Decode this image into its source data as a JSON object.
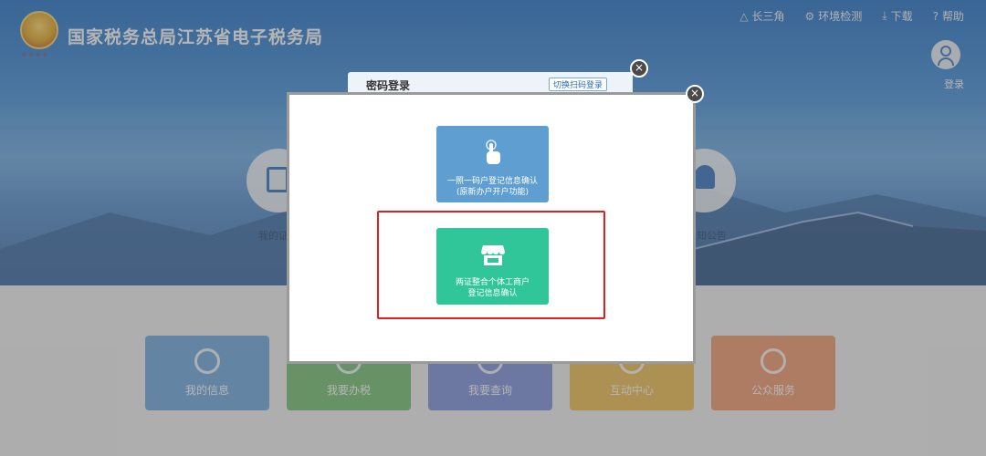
{
  "header": {
    "site_title": "国家税务总局江苏省电子税务局",
    "nav": [
      {
        "label": "长三角",
        "icon": "triangle-network-icon"
      },
      {
        "label": "环境检测",
        "icon": "wrench-icon"
      },
      {
        "label": "下载",
        "icon": "download-icon"
      },
      {
        "label": "帮助",
        "icon": "help-icon"
      }
    ],
    "login_label": "登录"
  },
  "background": {
    "left_circle_label": "我的证",
    "right_circle_label": "知公告",
    "tiles": [
      {
        "label": "我的信息",
        "color": "#6aa8df"
      },
      {
        "label": "我要办税",
        "color": "#72c06d"
      },
      {
        "label": "我要查询",
        "color": "#7b8fdc"
      },
      {
        "label": "互动中心",
        "color": "#f0bd4c"
      },
      {
        "label": "公众服务",
        "color": "#f2956a"
      }
    ]
  },
  "behind_dialog": {
    "title": "密码登录",
    "switch_label": "切换扫码登录"
  },
  "modal": {
    "options": [
      {
        "line1": "一照一码户登记信息确认",
        "line2": "(原新办户开户功能)",
        "icon": "hand-touch-icon",
        "color": "#5e9ed1"
      },
      {
        "line1": "两证整合个体工商户",
        "line2": "登记信息确认",
        "icon": "storefront-icon",
        "color": "#30c69a",
        "highlighted": true
      }
    ],
    "close_symbol": "×"
  }
}
